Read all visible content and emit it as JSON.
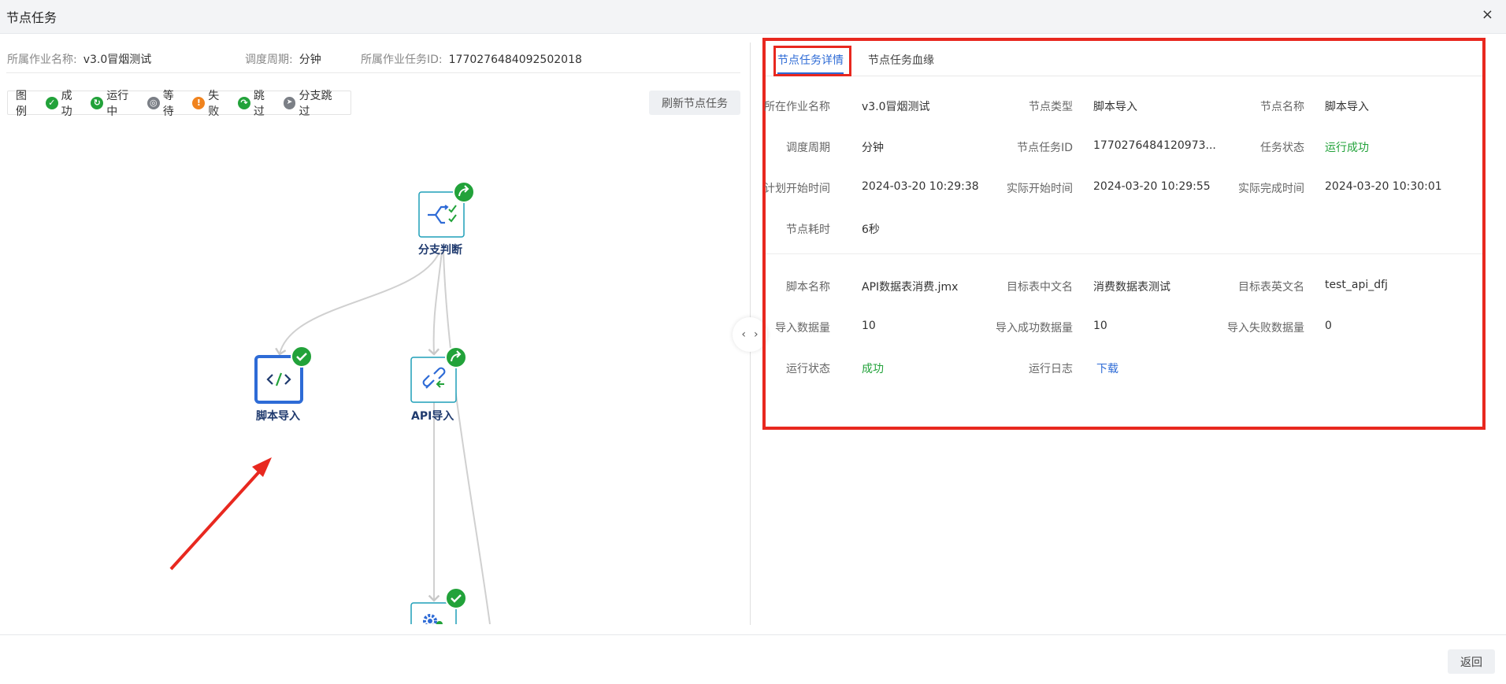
{
  "window": {
    "title": "节点任务",
    "close": "×"
  },
  "meta": {
    "job_name_label": "所属作业名称:",
    "job_name": "v3.0冒烟测试",
    "cycle_label": "调度周期:",
    "cycle": "分钟",
    "task_id_label": "所属作业任务ID:",
    "task_id": "1770276484092502018"
  },
  "legend": {
    "title": "图例",
    "items": [
      {
        "label": "成功",
        "color": "#22a23a",
        "glyph": "✓"
      },
      {
        "label": "运行中",
        "color": "#22a23a",
        "glyph": "↻"
      },
      {
        "label": "等待",
        "color": "#7b7f86",
        "glyph": "◎"
      },
      {
        "label": "失败",
        "color": "#f0831e",
        "glyph": "!"
      },
      {
        "label": "跳过",
        "color": "#22a23a",
        "glyph": "↷"
      },
      {
        "label": "分支跳过",
        "color": "#7b7f86",
        "glyph": "➤"
      }
    ]
  },
  "refresh_label": "刷新节点任务",
  "nodes": {
    "branch": {
      "label": "分支判断",
      "icon": "branch-decision-icon",
      "status": "skip"
    },
    "script": {
      "label": "脚本导入",
      "icon": "code-icon",
      "status": "success"
    },
    "api": {
      "label": "API导入",
      "icon": "api-link-icon",
      "status": "skip"
    },
    "gear": {
      "label": "",
      "icon": "gear-icon",
      "status": "success"
    }
  },
  "collapse": {
    "left": "‹",
    "right": "›"
  },
  "tabs": [
    {
      "label": "节点任务详情"
    },
    {
      "label": "节点任务血缘"
    }
  ],
  "details": {
    "job_name": {
      "label": "所在作业名称",
      "value": "v3.0冒烟测试"
    },
    "node_type": {
      "label": "节点类型",
      "value": "脚本导入"
    },
    "node_name": {
      "label": "节点名称",
      "value": "脚本导入"
    },
    "cycle": {
      "label": "调度周期",
      "value": "分钟"
    },
    "node_task_id": {
      "label": "节点任务ID",
      "value": "1770276484120973..."
    },
    "task_status": {
      "label": "任务状态",
      "value": "运行成功"
    },
    "plan_start": {
      "label": "计划开始时间",
      "value": "2024-03-20 10:29:38"
    },
    "actual_start": {
      "label": "实际开始时间",
      "value": "2024-03-20 10:29:55"
    },
    "actual_end": {
      "label": "实际完成时间",
      "value": "2024-03-20 10:30:01"
    },
    "duration": {
      "label": "节点耗时",
      "value": "6秒"
    },
    "script_name": {
      "label": "脚本名称",
      "value": "API数据表消费.jmx"
    },
    "target_cn": {
      "label": "目标表中文名",
      "value": "消费数据表测试"
    },
    "target_en": {
      "label": "目标表英文名",
      "value": "test_api_dfj"
    },
    "import_count": {
      "label": "导入数据量",
      "value": "10"
    },
    "import_success": {
      "label": "导入成功数据量",
      "value": "10"
    },
    "import_fail": {
      "label": "导入失败数据量",
      "value": "0"
    },
    "run_status": {
      "label": "运行状态",
      "value": "成功"
    },
    "run_log": {
      "label": "运行日志",
      "value": "下载"
    }
  },
  "footer": {
    "back_label": "返回"
  },
  "colors": {
    "accent": "#2e6bd6",
    "highlight": "#e8281f",
    "success": "#22a23a"
  }
}
